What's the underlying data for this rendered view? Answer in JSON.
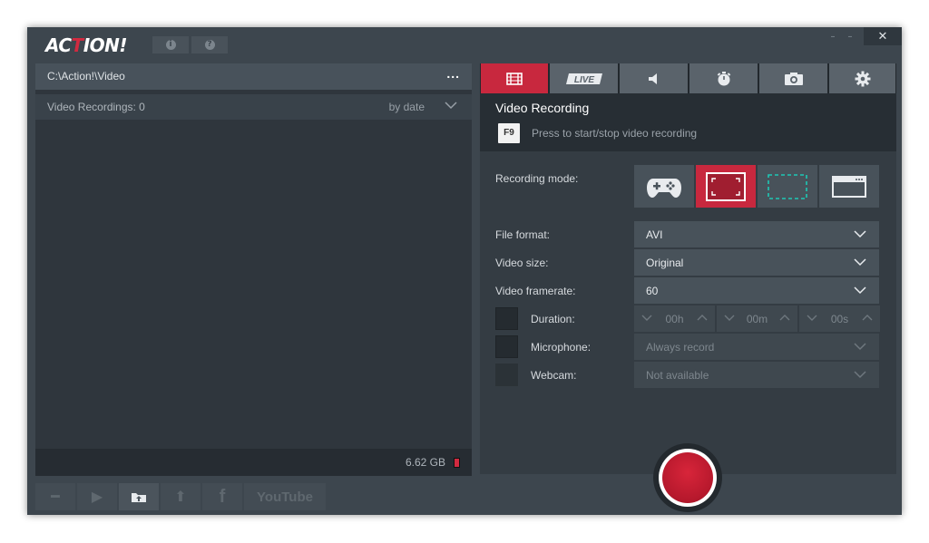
{
  "app": {
    "logo_prefix": "AC",
    "logo_accent": "T",
    "logo_suffix": "ION!",
    "info_icon": "info-icon",
    "help_icon": "help-icon",
    "minimize_label": "–",
    "close_label": "✕"
  },
  "left": {
    "path": "C:\\Action!\\Video",
    "path_more": "...",
    "recordings_label": "Video Recordings: 0",
    "sort_label": "by date",
    "storage": "6.62 GB"
  },
  "toolbar": {
    "buttons": [
      "minus-icon",
      "play-icon",
      "folder-upload-icon",
      "upload-icon",
      "facebook-icon",
      "youtube-icon"
    ],
    "facebook_label": "f",
    "youtube_label": "YouTube"
  },
  "tabs": [
    {
      "name": "video-recording",
      "icon": "film-icon",
      "active": true
    },
    {
      "name": "live",
      "label": "LIVE"
    },
    {
      "name": "audio",
      "icon": "speaker-icon"
    },
    {
      "name": "benchmark",
      "icon": "stopwatch-icon"
    },
    {
      "name": "screenshot",
      "icon": "camera-icon"
    },
    {
      "name": "settings",
      "icon": "gear-icon"
    }
  ],
  "section": {
    "title": "Video Recording",
    "hotkey": "F9",
    "hint": "Press to start/stop video recording"
  },
  "form": {
    "recording_mode_label": "Recording mode:",
    "modes": [
      "gamepad",
      "fullscreen",
      "area",
      "window"
    ],
    "active_mode": "fullscreen",
    "file_format_label": "File format:",
    "file_format": "AVI",
    "video_size_label": "Video size:",
    "video_size": "Original",
    "framerate_label": "Video framerate:",
    "framerate": "60",
    "duration_label": "Duration:",
    "duration_h": "00h",
    "duration_m": "00m",
    "duration_s": "00s",
    "microphone_label": "Microphone:",
    "microphone": "Always record",
    "webcam_label": "Webcam:",
    "webcam": "Not available"
  },
  "colors": {
    "accent": "#c8283e",
    "background": "#3d464e",
    "teal": "#1ec8b4"
  }
}
